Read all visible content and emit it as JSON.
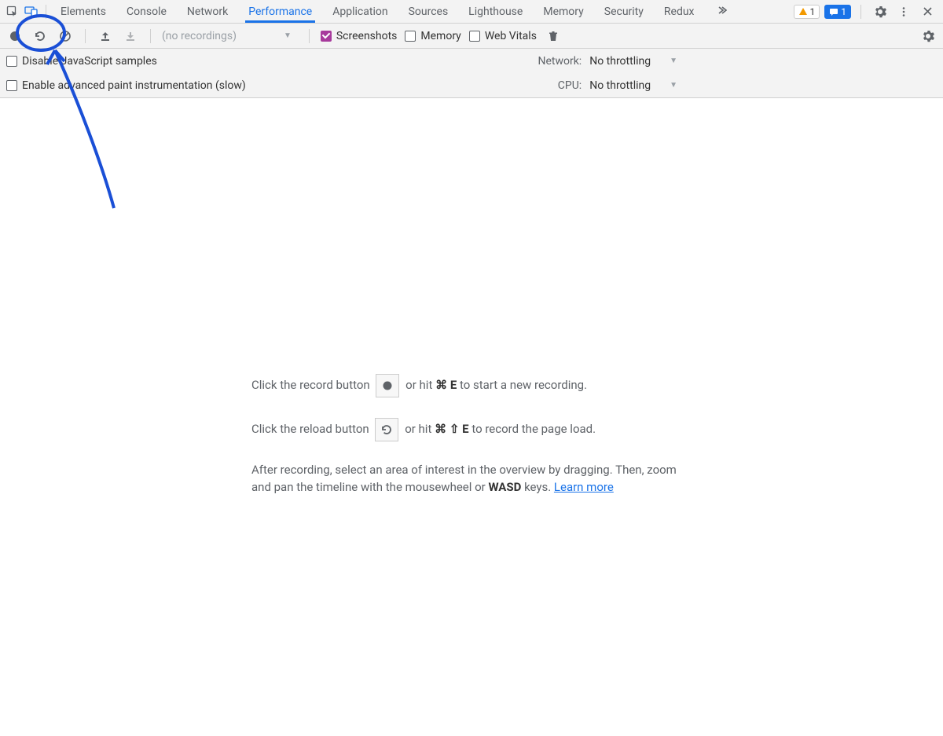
{
  "tabs": [
    "Elements",
    "Console",
    "Network",
    "Performance",
    "Application",
    "Sources",
    "Lighthouse",
    "Memory",
    "Security",
    "Redux"
  ],
  "active_tab_index": 3,
  "badges": {
    "warnings": "1",
    "messages": "1"
  },
  "toolbar": {
    "no_recordings": "(no recordings)",
    "screenshots": {
      "label": "Screenshots",
      "checked": true
    },
    "memory": {
      "label": "Memory",
      "checked": false
    },
    "web_vitals": {
      "label": "Web Vitals",
      "checked": false
    }
  },
  "options": {
    "disable_js": {
      "label": "Disable JavaScript samples",
      "checked": false
    },
    "enable_paint": {
      "label": "Enable advanced paint instrumentation (slow)",
      "checked": false
    },
    "network": {
      "label": "Network:",
      "value": "No throttling"
    },
    "cpu": {
      "label": "CPU:",
      "value": "No throttling"
    }
  },
  "hints": {
    "record_pre": "Click the record button",
    "record_mid": "or hit",
    "record_keys": "⌘ E",
    "record_post": "to start a new recording.",
    "reload_pre": "Click the reload button",
    "reload_mid": "or hit",
    "reload_keys": "⌘ ⇧ E",
    "reload_post": "to record the page load.",
    "after1": "After recording, select an area of interest in the overview by dragging. Then, zoom and pan the timeline with the mousewheel or ",
    "wasd": "WASD",
    "after2": " keys. ",
    "learn": "Learn more"
  }
}
